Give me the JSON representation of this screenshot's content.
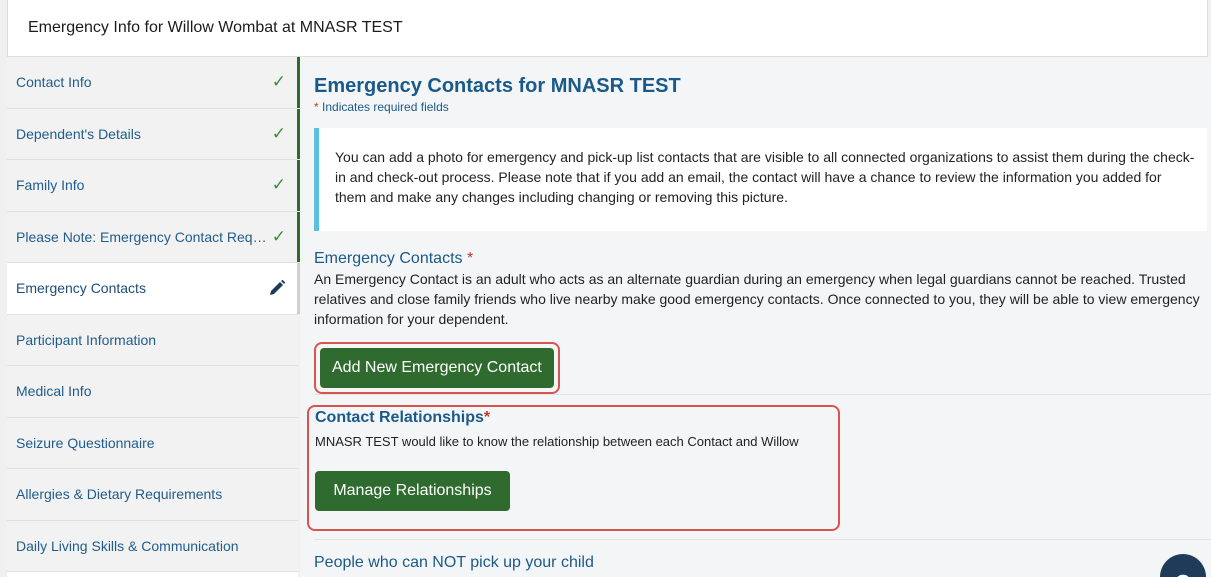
{
  "header": {
    "title": "Emergency Info for Willow Wombat at MNASR TEST"
  },
  "sidebar": {
    "items": [
      {
        "label": "Contact Info",
        "status": "done"
      },
      {
        "label": "Dependent's Details",
        "status": "done"
      },
      {
        "label": "Family Info",
        "status": "done"
      },
      {
        "label": "Please Note: Emergency Contact Requ...",
        "status": "done"
      },
      {
        "label": "Emergency Contacts",
        "status": "active"
      },
      {
        "label": "Participant Information",
        "status": ""
      },
      {
        "label": "Medical Info",
        "status": ""
      },
      {
        "label": "Seizure Questionnaire",
        "status": ""
      },
      {
        "label": "Allergies & Dietary Requirements",
        "status": ""
      },
      {
        "label": "Daily Living Skills & Communication",
        "status": ""
      }
    ]
  },
  "main": {
    "title": "Emergency Contacts for MNASR TEST",
    "required_star": "*",
    "required_note": " Indicates required fields",
    "info_text": "You can add a photo for emergency and pick-up list contacts that are visible to all connected organizations to assist them during the check-in and check-out process. Please note that if you add an email, the contact will have a chance to review the information you added for them and make any changes including changing or removing this picture.",
    "emergency_section": {
      "title": "Emergency Contacts",
      "star": "*",
      "description": "An Emergency Contact is an adult who acts as an alternate guardian during an emergency when legal guardians cannot be reached. Trusted relatives and close family friends who live nearby make good emergency contacts. Once connected to you, they will be able to view emergency information for your dependent.",
      "add_button": "Add New Emergency Contact"
    },
    "relationships": {
      "title": "Contact Relationships",
      "star": "*",
      "description": "MNASR TEST would like to know the relationship between each Contact and Willow",
      "button": "Manage Relationships"
    },
    "no_pickup_title": "People who can NOT pick up your child"
  },
  "help": {
    "label": "?",
    "icon": "help-icon"
  },
  "colors": {
    "accent_blue": "#1a5a8a",
    "button_green": "#2f6b2f",
    "highlight_red": "#d9534f",
    "info_border": "#5bc0de"
  }
}
